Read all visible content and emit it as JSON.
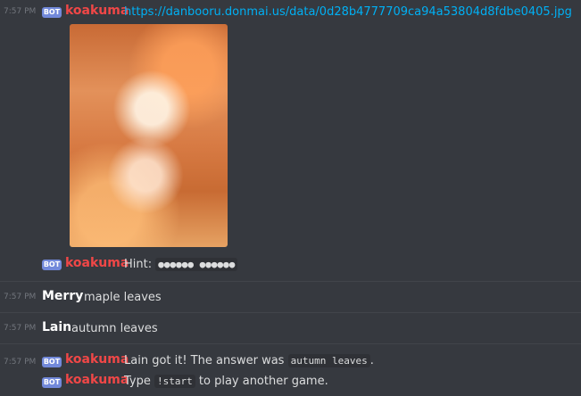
{
  "messages": [
    {
      "time": "7:57 PM",
      "badge": "BOT",
      "author": "koakuma",
      "link": "https://danbooru.donmai.us/data/0d28b4777709ca94a53804d8fdbe0405.jpg",
      "image_alt": "anime illustration"
    },
    {
      "badge": "BOT",
      "author": "koakuma",
      "hint_label": "Hint:",
      "hint_value": "●●●●●● ●●●●●●"
    },
    {
      "time": "7:57 PM",
      "author": "Merry",
      "text": "maple leaves"
    },
    {
      "time": "7:57 PM",
      "author": "Lain",
      "text": "autumn leaves"
    },
    {
      "time": "7:57 PM",
      "badge": "BOT",
      "author": "koakuma",
      "text_before": "Lain got it! The answer was",
      "answer": "autumn leaves",
      "text_after": "."
    },
    {
      "badge": "BOT",
      "author": "koakuma",
      "text_before": "Type",
      "command": "!start",
      "text_after": "to play another game."
    }
  ],
  "colors": {
    "background": "#36393f",
    "bot_badge": "#7289da",
    "bot_name": "#f04747",
    "link": "#00b0f4",
    "timestamp": "#72767d"
  }
}
